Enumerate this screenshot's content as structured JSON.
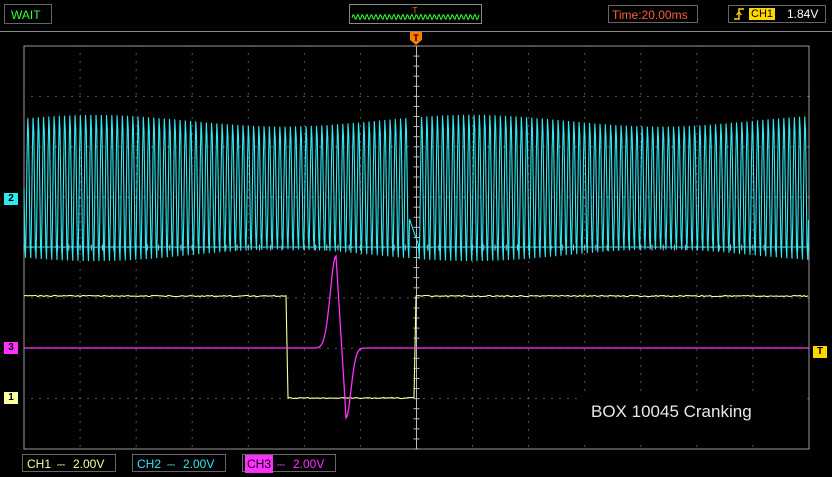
{
  "status": {
    "label": "WAIT",
    "color": "#33ff33"
  },
  "timebase": {
    "label": "Time:20.00ms",
    "color": "#ff5b3c"
  },
  "trigger": {
    "source": "CH1",
    "level": "1.84V",
    "edge_icon": "rising-edge-icon",
    "marker_label": "T"
  },
  "trigger_overview": {
    "marker_label": "T"
  },
  "channels": [
    {
      "id": "CH1",
      "marker": "1",
      "coupling": "DC",
      "volts_div": "2.00V",
      "color": "#ffffa0"
    },
    {
      "id": "CH2",
      "marker": "2",
      "coupling": "DC",
      "volts_div": "2.00V",
      "color": "#30e8f0"
    },
    {
      "id": "CH3",
      "marker": "3",
      "coupling": "DC",
      "volts_div": "2.00V",
      "color": "#ff30ff"
    }
  ],
  "watermark": "BOX 10045 Cranking",
  "colors": {
    "grid": "#999999",
    "background": "#000000",
    "frame": "#888888"
  }
}
